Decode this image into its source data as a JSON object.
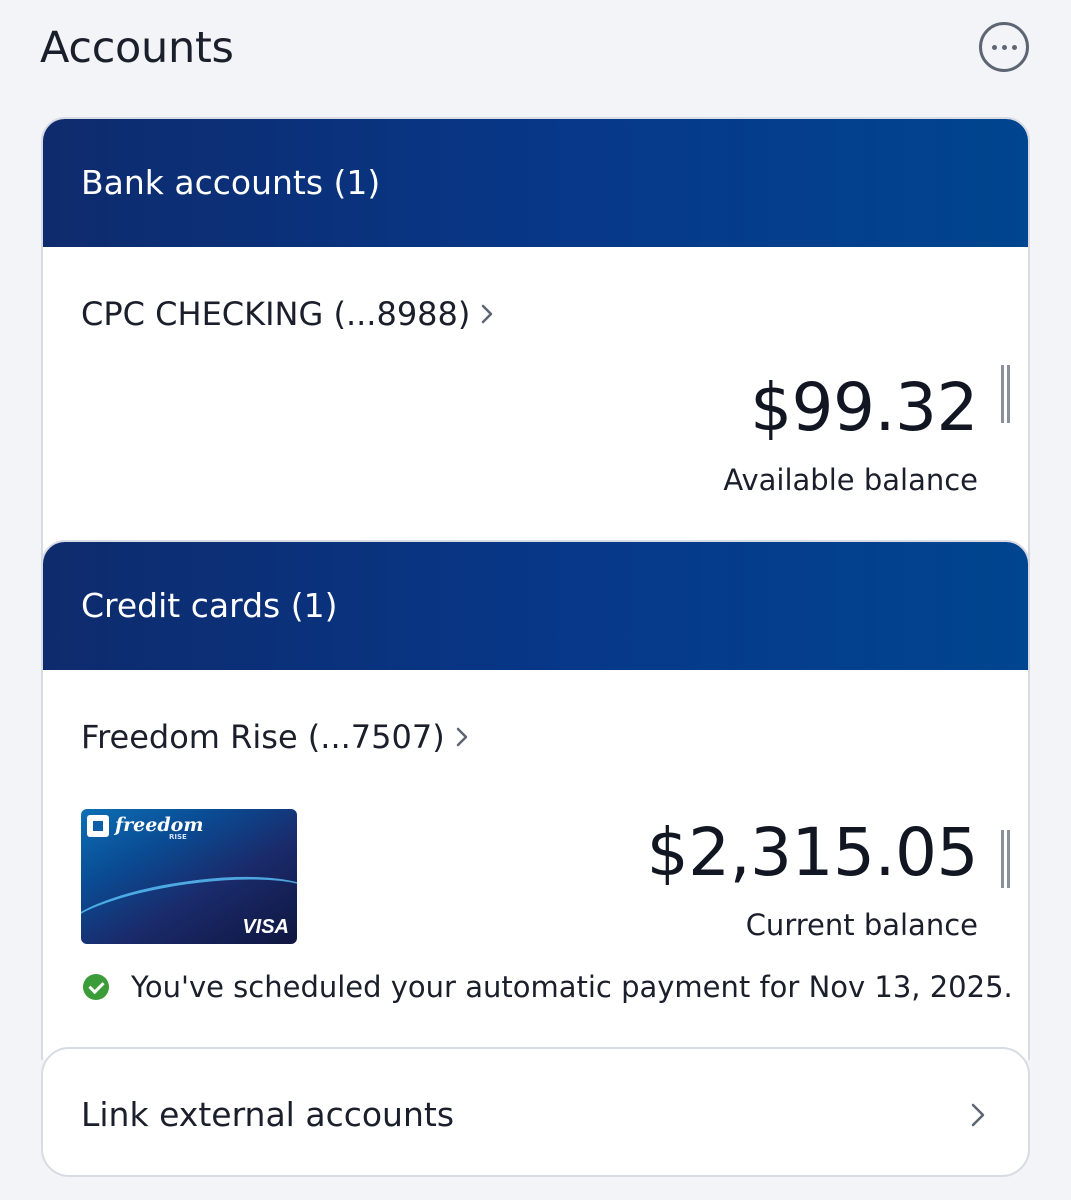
{
  "header": {
    "title": "Accounts",
    "more_icon": "more-horizontal-icon"
  },
  "bank_accounts": {
    "section_title": "Bank accounts (1)",
    "accounts": [
      {
        "name": "CPC CHECKING (...8988)",
        "balance": "$99.32",
        "balance_label": "Available balance"
      }
    ]
  },
  "credit_cards": {
    "section_title": "Credit cards (1)",
    "cards": [
      {
        "name": "Freedom Rise (...7507)",
        "balance": "$2,315.05",
        "balance_label": "Current balance",
        "card_art": {
          "brand": "freedom",
          "brand_sub": "RISE",
          "network": "VISA"
        },
        "autopay_message": "You've scheduled your automatic payment for Nov 13, 2025."
      }
    ]
  },
  "link_external": {
    "label": "Link external accounts"
  },
  "colors": {
    "header_gradient_start": "#0e2b6d",
    "header_gradient_end": "#00458f",
    "success": "#3b9c3a",
    "background": "#f2f4f8"
  }
}
